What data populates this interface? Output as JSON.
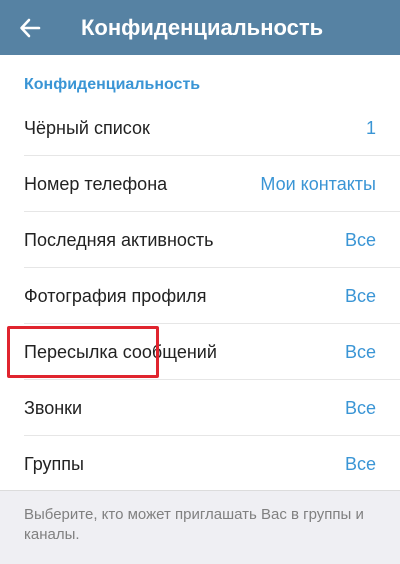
{
  "header": {
    "title": "Конфиденциальность",
    "background_color": "#5682a3",
    "back_icon": "arrow-left-icon"
  },
  "section": {
    "title": "Конфиденциальность",
    "accent_color": "#3a95d5"
  },
  "rows": [
    {
      "label": "Чёрный список",
      "value": "1"
    },
    {
      "label": "Номер телефона",
      "value": "Мои контакты"
    },
    {
      "label": "Последняя активность",
      "value": "Все"
    },
    {
      "label": "Фотография профиля",
      "value": "Все"
    },
    {
      "label": "Пересылка сообщений",
      "value": "Все"
    },
    {
      "label": "Звонки",
      "value": "Все",
      "highlighted": true
    },
    {
      "label": "Группы",
      "value": "Все"
    }
  ],
  "footer": {
    "text": "Выберите, кто может приглашать Вас в группы и каналы."
  },
  "colors": {
    "highlight": "#e0242e",
    "text": "#222222",
    "muted": "#808080"
  }
}
